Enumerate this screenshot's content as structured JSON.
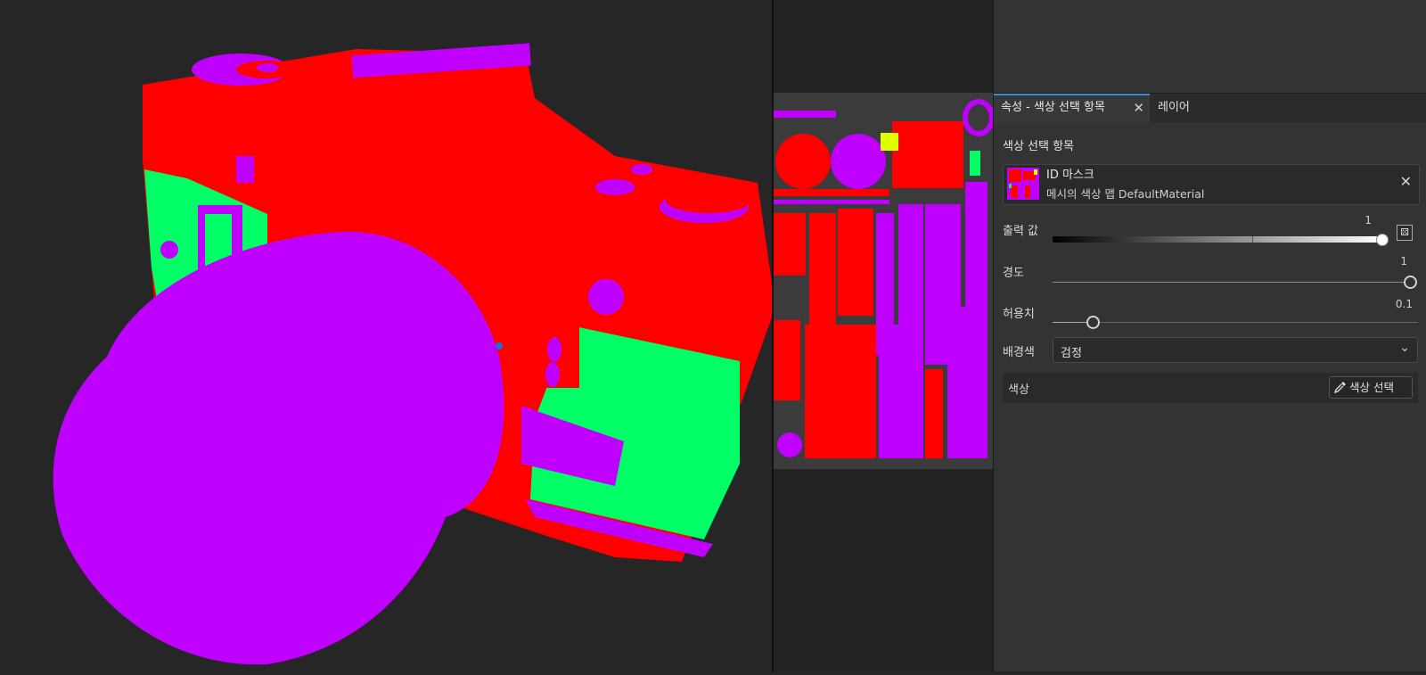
{
  "tabs": {
    "active_label": "속성 - 색상 선택 항목",
    "inactive_label": "레이어",
    "close_glyph": "✕"
  },
  "section_title": "색상 선택 항목",
  "source": {
    "title": "ID 마스크",
    "subtitle": "메시의 색상 맵 DefaultMaterial",
    "close_glyph": "✕"
  },
  "output": {
    "label": "출력 값",
    "value": "1",
    "random_icon": "dice-icon"
  },
  "hardness": {
    "label": "경도",
    "value": "1"
  },
  "tolerance": {
    "label": "허용치",
    "value": "0.1"
  },
  "background": {
    "label": "배경색",
    "selected": "검정"
  },
  "color": {
    "label": "색상",
    "picker_label": "색상 선택"
  },
  "colors": {
    "red": "#ff0000",
    "purple": "#bf00ff",
    "green": "#00ff66",
    "accent": "#3b8bd6"
  }
}
